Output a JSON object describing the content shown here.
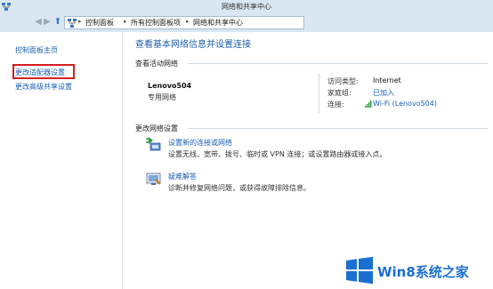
{
  "window": {
    "title": "网络和共享中心"
  },
  "address": {
    "crumbs": [
      "控制面板",
      "所有控制面板项",
      "网络和共享中心"
    ]
  },
  "left": {
    "home": "控制面板主页",
    "adapter": "更改适配器设置",
    "advanced": "更改高级共享设置"
  },
  "main": {
    "title": "查看基本网络信息并设置连接",
    "active_header": "查看活动网络",
    "network": {
      "name": "Lenovo504",
      "type": "专用网络"
    },
    "props": {
      "access_label": "访问类型:",
      "access_value": "Internet",
      "home_label": "家庭组:",
      "home_value": "已加入",
      "conn_label": "连接:",
      "conn_value": "Wi-Fi (Lenovo504)"
    },
    "change_header": "更改网络设置",
    "tasks": [
      {
        "link": "设置新的连接或网络",
        "desc": "设置无线、宽带、拨号、临时或 VPN 连接；或设置路由器或接入点。"
      },
      {
        "link": "疑难解答",
        "desc": "诊断并修复网络问题，或获得故障排除信息。"
      }
    ]
  },
  "watermark": {
    "text": "Win8系统之家"
  },
  "colors": {
    "link": "#1a5fb4",
    "title": "#1d5fa6",
    "highlight": "#d42020",
    "brand": "#1b6fd1"
  }
}
